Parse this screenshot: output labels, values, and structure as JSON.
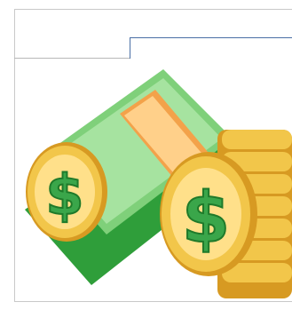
{
  "window": {
    "title": ""
  },
  "field": {
    "value": ""
  },
  "illustration": {
    "subject": "money-illustration",
    "colors": {
      "bill_green": "#2f9e3a",
      "bill_light": "#7fd07a",
      "coin_gold": "#f2c64a",
      "coin_dark": "#d79a22",
      "dollar_green": "#3aa64a",
      "band_orange": "#f3a24a"
    }
  }
}
